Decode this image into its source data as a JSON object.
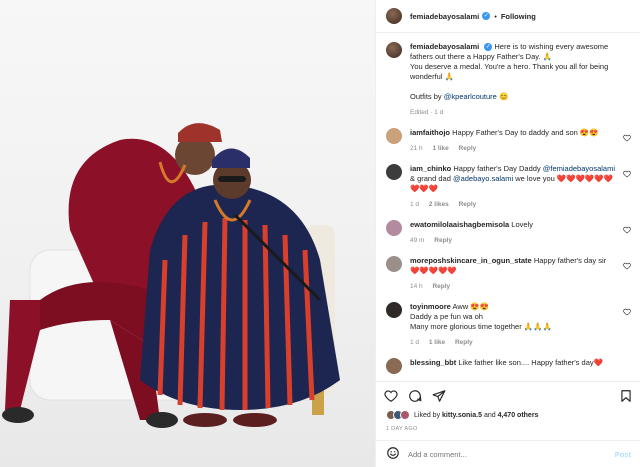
{
  "post_header": {
    "username": "femiadebayosalami",
    "follow_state": "Following"
  },
  "caption": {
    "username": "femiadebayosalami",
    "text1": "Here is to wishing every awesome fathers out there a Happy Father's Day. 🙏",
    "text2": "You deserve a medal. You're a hero. Thank you all for being wonderful 🙏",
    "outfits_prefix": "Outfits by",
    "outfits_handle": "@kpearlcouture",
    "outfits_suffix": "😊",
    "meta": "Edited · 1 d"
  },
  "comments": [
    {
      "username": "iamfaithojo",
      "text": "Happy Father's Day to daddy and son 😍😍",
      "time": "21 h",
      "likes": "1 like",
      "reply": "Reply",
      "avatar_color": "#c9a17a"
    },
    {
      "username": "iam_chinko",
      "text_prefix": "Happy father's Day Daddy",
      "mention1": "@femiadebayosalami",
      "text_mid": "& grand dad",
      "mention2": "@adebayo.salami",
      "text_suffix": "we love you ❤️❤️❤️❤️❤️❤️❤️❤️❤️",
      "time": "1 d",
      "likes": "2 likes",
      "reply": "Reply",
      "avatar_color": "#3c3c3c"
    },
    {
      "username": "ewatomilolaaishagbemisola",
      "text": "Lovely",
      "time": "49 m",
      "likes": "",
      "reply": "Reply",
      "avatar_color": "#b48aa0"
    },
    {
      "username": "moreposhskincare_in_ogun_state",
      "text": "Happy father's day sir ❤️❤️❤️❤️❤️",
      "time": "14 h",
      "likes": "",
      "reply": "Reply",
      "avatar_color": "#9a8f8a"
    },
    {
      "username": "toyinmoore",
      "text": "Aww 😍😍",
      "line2": "Daddy a pe fun wa oh",
      "line3": "Many more glorious time together 🙏🙏🙏",
      "time": "1 d",
      "likes": "1 like",
      "reply": "Reply",
      "avatar_color": "#2f2a28"
    },
    {
      "username": "blessing_bbt",
      "text": "Like father like son.... Happy father's day❤️",
      "time": "",
      "likes": "",
      "reply": "",
      "avatar_color": "#8a6a55"
    }
  ],
  "likes": {
    "text_prefix": "Liked by",
    "user": "kitty.sonia.5",
    "text_suffix": "and",
    "count": "4,470 others"
  },
  "time_ago": "1 DAY AGO",
  "add_comment": {
    "placeholder": "Add a comment...",
    "post_label": "Post"
  },
  "colors": {
    "accent": "#3897f0",
    "link": "#00376b",
    "muted": "#8e8e8e",
    "post_disabled": "#b2dffc"
  }
}
